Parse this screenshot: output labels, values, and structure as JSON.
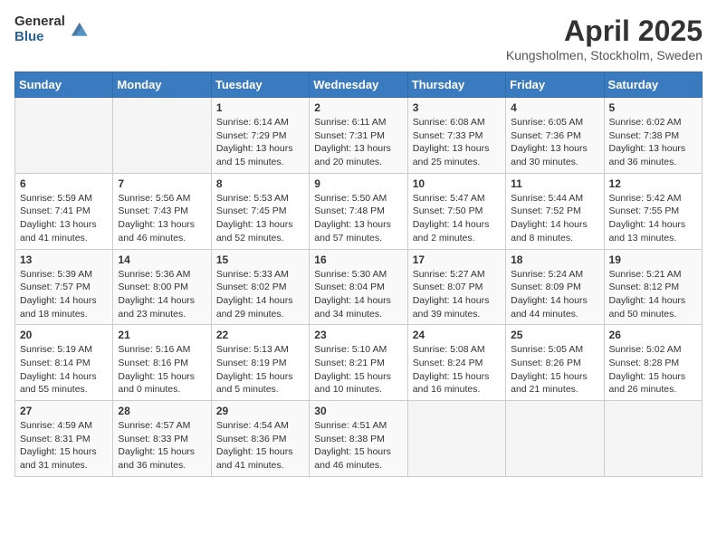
{
  "header": {
    "logo_general": "General",
    "logo_blue": "Blue",
    "month_title": "April 2025",
    "subtitle": "Kungsholmen, Stockholm, Sweden"
  },
  "weekdays": [
    "Sunday",
    "Monday",
    "Tuesday",
    "Wednesday",
    "Thursday",
    "Friday",
    "Saturday"
  ],
  "weeks": [
    [
      {
        "day": "",
        "info": ""
      },
      {
        "day": "",
        "info": ""
      },
      {
        "day": "1",
        "info": "Sunrise: 6:14 AM\nSunset: 7:29 PM\nDaylight: 13 hours and 15 minutes."
      },
      {
        "day": "2",
        "info": "Sunrise: 6:11 AM\nSunset: 7:31 PM\nDaylight: 13 hours and 20 minutes."
      },
      {
        "day": "3",
        "info": "Sunrise: 6:08 AM\nSunset: 7:33 PM\nDaylight: 13 hours and 25 minutes."
      },
      {
        "day": "4",
        "info": "Sunrise: 6:05 AM\nSunset: 7:36 PM\nDaylight: 13 hours and 30 minutes."
      },
      {
        "day": "5",
        "info": "Sunrise: 6:02 AM\nSunset: 7:38 PM\nDaylight: 13 hours and 36 minutes."
      }
    ],
    [
      {
        "day": "6",
        "info": "Sunrise: 5:59 AM\nSunset: 7:41 PM\nDaylight: 13 hours and 41 minutes."
      },
      {
        "day": "7",
        "info": "Sunrise: 5:56 AM\nSunset: 7:43 PM\nDaylight: 13 hours and 46 minutes."
      },
      {
        "day": "8",
        "info": "Sunrise: 5:53 AM\nSunset: 7:45 PM\nDaylight: 13 hours and 52 minutes."
      },
      {
        "day": "9",
        "info": "Sunrise: 5:50 AM\nSunset: 7:48 PM\nDaylight: 13 hours and 57 minutes."
      },
      {
        "day": "10",
        "info": "Sunrise: 5:47 AM\nSunset: 7:50 PM\nDaylight: 14 hours and 2 minutes."
      },
      {
        "day": "11",
        "info": "Sunrise: 5:44 AM\nSunset: 7:52 PM\nDaylight: 14 hours and 8 minutes."
      },
      {
        "day": "12",
        "info": "Sunrise: 5:42 AM\nSunset: 7:55 PM\nDaylight: 14 hours and 13 minutes."
      }
    ],
    [
      {
        "day": "13",
        "info": "Sunrise: 5:39 AM\nSunset: 7:57 PM\nDaylight: 14 hours and 18 minutes."
      },
      {
        "day": "14",
        "info": "Sunrise: 5:36 AM\nSunset: 8:00 PM\nDaylight: 14 hours and 23 minutes."
      },
      {
        "day": "15",
        "info": "Sunrise: 5:33 AM\nSunset: 8:02 PM\nDaylight: 14 hours and 29 minutes."
      },
      {
        "day": "16",
        "info": "Sunrise: 5:30 AM\nSunset: 8:04 PM\nDaylight: 14 hours and 34 minutes."
      },
      {
        "day": "17",
        "info": "Sunrise: 5:27 AM\nSunset: 8:07 PM\nDaylight: 14 hours and 39 minutes."
      },
      {
        "day": "18",
        "info": "Sunrise: 5:24 AM\nSunset: 8:09 PM\nDaylight: 14 hours and 44 minutes."
      },
      {
        "day": "19",
        "info": "Sunrise: 5:21 AM\nSunset: 8:12 PM\nDaylight: 14 hours and 50 minutes."
      }
    ],
    [
      {
        "day": "20",
        "info": "Sunrise: 5:19 AM\nSunset: 8:14 PM\nDaylight: 14 hours and 55 minutes."
      },
      {
        "day": "21",
        "info": "Sunrise: 5:16 AM\nSunset: 8:16 PM\nDaylight: 15 hours and 0 minutes."
      },
      {
        "day": "22",
        "info": "Sunrise: 5:13 AM\nSunset: 8:19 PM\nDaylight: 15 hours and 5 minutes."
      },
      {
        "day": "23",
        "info": "Sunrise: 5:10 AM\nSunset: 8:21 PM\nDaylight: 15 hours and 10 minutes."
      },
      {
        "day": "24",
        "info": "Sunrise: 5:08 AM\nSunset: 8:24 PM\nDaylight: 15 hours and 16 minutes."
      },
      {
        "day": "25",
        "info": "Sunrise: 5:05 AM\nSunset: 8:26 PM\nDaylight: 15 hours and 21 minutes."
      },
      {
        "day": "26",
        "info": "Sunrise: 5:02 AM\nSunset: 8:28 PM\nDaylight: 15 hours and 26 minutes."
      }
    ],
    [
      {
        "day": "27",
        "info": "Sunrise: 4:59 AM\nSunset: 8:31 PM\nDaylight: 15 hours and 31 minutes."
      },
      {
        "day": "28",
        "info": "Sunrise: 4:57 AM\nSunset: 8:33 PM\nDaylight: 15 hours and 36 minutes."
      },
      {
        "day": "29",
        "info": "Sunrise: 4:54 AM\nSunset: 8:36 PM\nDaylight: 15 hours and 41 minutes."
      },
      {
        "day": "30",
        "info": "Sunrise: 4:51 AM\nSunset: 8:38 PM\nDaylight: 15 hours and 46 minutes."
      },
      {
        "day": "",
        "info": ""
      },
      {
        "day": "",
        "info": ""
      },
      {
        "day": "",
        "info": ""
      }
    ]
  ]
}
